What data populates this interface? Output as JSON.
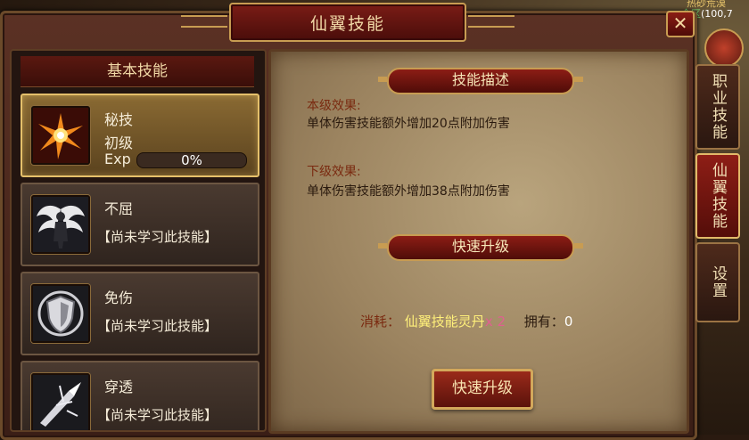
{
  "hud": {
    "line1": "热砂荒漠",
    "zone": "全区",
    "coords": "(100,7"
  },
  "window": {
    "title": "仙翼技能",
    "close_glyph": "✕"
  },
  "left": {
    "header": "基本技能",
    "skills": [
      {
        "name": "秘技",
        "level": "初级",
        "exp_label": "Exp",
        "exp_text": "0%",
        "exp_progress": 0,
        "icon": "flame-burst-icon"
      },
      {
        "name": "不屈",
        "status": "【尚未学习此技能】",
        "icon": "winged-figure-icon"
      },
      {
        "name": "免伤",
        "status": "【尚未学习此技能】",
        "icon": "shield-icon"
      },
      {
        "name": "穿透",
        "status": "【尚未学习此技能】",
        "icon": "piercing-blade-icon"
      }
    ]
  },
  "right": {
    "desc_ribbon": "技能描述",
    "current_label": "本级效果:",
    "current_text": "单体伤害技能额外增加20点附加伤害",
    "next_label": "下级效果:",
    "next_text": "单体伤害技能额外增加38点附加伤害",
    "upgrade_ribbon": "快速升级",
    "cost_label": "消耗：",
    "cost_item": "仙翼技能灵丹",
    "cost_mult": "x 2",
    "own_label": "拥有：",
    "own_value": "0",
    "quick_button": "快速升级"
  },
  "tabs": [
    {
      "label": "职业技能",
      "active": false
    },
    {
      "label": "仙翼技能",
      "active": true
    },
    {
      "label": "设置",
      "active": false
    }
  ],
  "colors": {
    "accent_gold": "#c89c52",
    "title_red": "#7a1c16",
    "parchment": "#b9a47d"
  }
}
